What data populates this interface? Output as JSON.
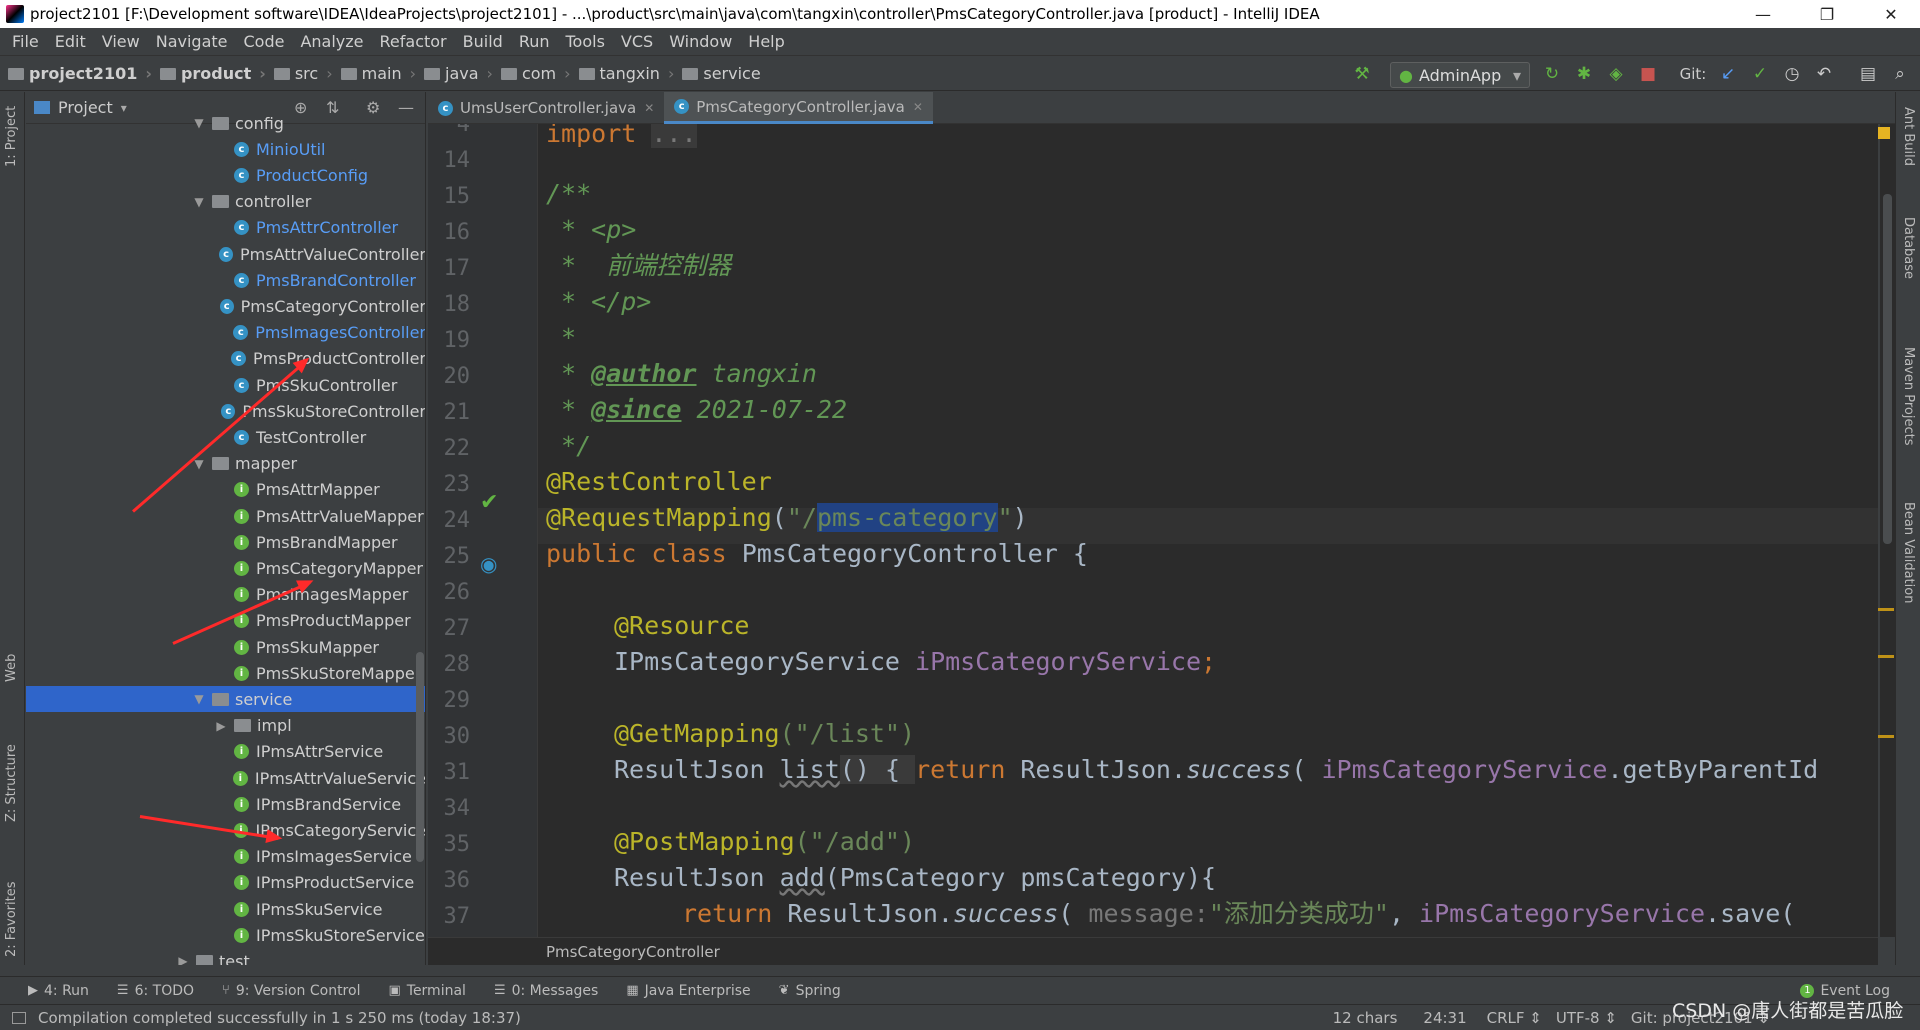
{
  "window": {
    "title": "project2101 [F:\\Development software\\IDEA\\IdeaProjects\\project2101] - ...\\product\\src\\main\\java\\com\\tangxin\\controller\\PmsCategoryController.java [product] - IntelliJ IDEA",
    "minimize": "—",
    "maximize": "❐",
    "close": "✕"
  },
  "menu": [
    "File",
    "Edit",
    "View",
    "Navigate",
    "Code",
    "Analyze",
    "Refactor",
    "Build",
    "Run",
    "Tools",
    "VCS",
    "Window",
    "Help"
  ],
  "breadcrumbs": [
    "project2101",
    "product",
    "src",
    "main",
    "java",
    "com",
    "tangxin",
    "service"
  ],
  "toolbar": {
    "run_config": "AdminApp",
    "git_label": "Git:"
  },
  "project_panel": {
    "title": "Project",
    "tree": [
      {
        "label": "config",
        "type": "folder",
        "level": 1,
        "expanded": true
      },
      {
        "label": "MinioUtil",
        "type": "class",
        "level": 2,
        "blue": true
      },
      {
        "label": "ProductConfig",
        "type": "class",
        "level": 2,
        "blue": true
      },
      {
        "label": "controller",
        "type": "folder",
        "level": 1,
        "expanded": true
      },
      {
        "label": "PmsAttrController",
        "type": "class",
        "level": 2,
        "blue": true
      },
      {
        "label": "PmsAttrValueController",
        "type": "class",
        "level": 2,
        "blue": false
      },
      {
        "label": "PmsBrandController",
        "type": "class",
        "level": 2,
        "blue": true
      },
      {
        "label": "PmsCategoryController",
        "type": "class",
        "level": 2,
        "blue": false
      },
      {
        "label": "PmsImagesController",
        "type": "class",
        "level": 2,
        "blue": true
      },
      {
        "label": "PmsProductController",
        "type": "class",
        "level": 2,
        "blue": false
      },
      {
        "label": "PmsSkuController",
        "type": "class",
        "level": 2,
        "blue": false
      },
      {
        "label": "PmsSkuStoreController",
        "type": "class",
        "level": 2,
        "blue": false
      },
      {
        "label": "TestController",
        "type": "class",
        "level": 2,
        "blue": false
      },
      {
        "label": "mapper",
        "type": "folder",
        "level": 1,
        "expanded": true
      },
      {
        "label": "PmsAttrMapper",
        "type": "interface",
        "level": 2
      },
      {
        "label": "PmsAttrValueMapper",
        "type": "interface",
        "level": 2
      },
      {
        "label": "PmsBrandMapper",
        "type": "interface",
        "level": 2
      },
      {
        "label": "PmsCategoryMapper",
        "type": "interface",
        "level": 2
      },
      {
        "label": "PmsImagesMapper",
        "type": "interface",
        "level": 2
      },
      {
        "label": "PmsProductMapper",
        "type": "interface",
        "level": 2
      },
      {
        "label": "PmsSkuMapper",
        "type": "interface",
        "level": 2
      },
      {
        "label": "PmsSkuStoreMapper",
        "type": "interface",
        "level": 2
      },
      {
        "label": "service",
        "type": "folder",
        "level": 1,
        "expanded": true,
        "selected": true
      },
      {
        "label": "impl",
        "type": "folder",
        "level": 2,
        "expanded": false
      },
      {
        "label": "IPmsAttrService",
        "type": "interface",
        "level": 2
      },
      {
        "label": "IPmsAttrValueService",
        "type": "interface",
        "level": 2
      },
      {
        "label": "IPmsBrandService",
        "type": "interface",
        "level": 2
      },
      {
        "label": "IPmsCategoryService",
        "type": "interface",
        "level": 2
      },
      {
        "label": "IPmsImagesService",
        "type": "interface",
        "level": 2
      },
      {
        "label": "IPmsProductService",
        "type": "interface",
        "level": 2
      },
      {
        "label": "IPmsSkuService",
        "type": "interface",
        "level": 2
      },
      {
        "label": "IPmsSkuStoreService",
        "type": "interface",
        "level": 2
      },
      {
        "label": "test",
        "type": "folder",
        "level": 0,
        "expanded": false
      }
    ]
  },
  "tabs": [
    {
      "label": "UmsUserController.java",
      "active": false
    },
    {
      "label": "PmsCategoryController.java",
      "active": true
    }
  ],
  "editor": {
    "line_numbers": [
      "4",
      "14",
      "15",
      "16",
      "17",
      "18",
      "19",
      "20",
      "21",
      "22",
      "23",
      "24",
      "25",
      "26",
      "27",
      "28",
      "29",
      "30",
      "31",
      "34",
      "35",
      "36",
      "37"
    ],
    "lines": {
      "l4_kw": "import",
      "l4_fold": "...",
      "l15": "/**",
      "l16": " * <p>",
      "l17": " *  前端控制器",
      "l18": " * </p>",
      "l19": " *",
      "l20_pre": " * ",
      "l20_tag": "@author",
      "l20_val": " tangxin",
      "l21_pre": " * ",
      "l21_tag": "@since",
      "l21_val": " 2021-07-22",
      "l22": " */",
      "l23": "@RestController",
      "l24_ann": "@RequestMapping",
      "l24_open": "(",
      "l24_q1": "\"/",
      "l24_sel": "pms-category",
      "l24_q2": "\"",
      "l24_close": ")",
      "l25_kw1": "public",
      "l25_kw2": "class",
      "l25_name": " PmsCategoryController {",
      "l27": "@Resource",
      "l28_type": "IPmsCategoryService ",
      "l28_field": "iPmsCategoryService",
      "l28_semi": ";",
      "l30_ann": "@GetMapping",
      "l30_str": "(\"/list\")",
      "l31_type": "ResultJson ",
      "l31_m": "list",
      "l31_paren": "()",
      "l31_brace": " { ",
      "l31_ret": "return",
      "l31_rest1": " ResultJson.",
      "l31_success": "success",
      "l31_rest2": "( ",
      "l31_field": "iPmsCategoryService",
      "l31_rest3": ".getByParentId",
      "l35_ann": "@PostMapping",
      "l35_str": "(\"/add\")",
      "l36_type": "ResultJson ",
      "l36_m": "add",
      "l36_rest": "(PmsCategory pmsCategory){",
      "l37_ret": "return",
      "l37_rest1": " ResultJson.",
      "l37_success": "success",
      "l37_rest2": "( ",
      "l37_hint": "message:",
      "l37_str": "\"添加分类成功\"",
      "l37_rest3": ", ",
      "l37_field": "iPmsCategoryService",
      "l37_rest4": ".save("
    },
    "breadcrumb": "PmsCategoryController"
  },
  "right_tools": [
    "Ant Build",
    "Database",
    "Maven Projects",
    "Bean Validation"
  ],
  "left_tools": [
    "1: Project",
    "Web",
    "Z: Structure",
    "2: Favorites"
  ],
  "bottom_tools": [
    {
      "label": "4: Run",
      "icon": "▶"
    },
    {
      "label": "6: TODO",
      "icon": "☰"
    },
    {
      "label": "9: Version Control",
      "icon": "⑂"
    },
    {
      "label": "Terminal",
      "icon": "▣"
    },
    {
      "label": "0: Messages",
      "icon": "☰"
    },
    {
      "label": "Java Enterprise",
      "icon": "▦"
    },
    {
      "label": "Spring",
      "icon": "❦"
    }
  ],
  "event_log": "Event Log",
  "event_count": "1",
  "status": {
    "message": "Compilation completed successfully in 1 s 250 ms (today 18:37)",
    "chars": "12 chars",
    "position": "24:31",
    "line_sep": "CRLF ⇕",
    "encoding": "UTF-8 ⇕",
    "git": "Git: project2101 ⇕",
    "watermark": "CSDN @唐人街都是苦瓜脸"
  }
}
